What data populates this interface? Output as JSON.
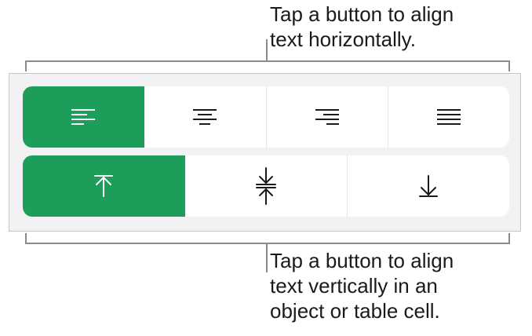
{
  "callouts": {
    "horizontal": "Tap a button to align\ntext horizontally.",
    "vertical": "Tap a button to align\ntext vertically in an\nobject or table cell."
  },
  "horizontal_alignment": {
    "buttons": [
      {
        "icon": "align-left-icon",
        "selected": true
      },
      {
        "icon": "align-center-icon",
        "selected": false
      },
      {
        "icon": "align-right-icon",
        "selected": false
      },
      {
        "icon": "align-justify-icon",
        "selected": false
      }
    ]
  },
  "vertical_alignment": {
    "buttons": [
      {
        "icon": "align-top-icon",
        "selected": true
      },
      {
        "icon": "align-middle-icon",
        "selected": false
      },
      {
        "icon": "align-bottom-icon",
        "selected": false
      }
    ]
  },
  "colors": {
    "selected": "#1c9e5a",
    "panel": "#f2f2f4",
    "bracket": "#8a8a8a"
  }
}
